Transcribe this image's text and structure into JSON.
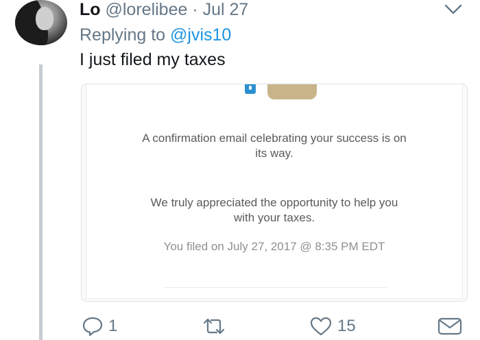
{
  "tweet": {
    "name": "Lo",
    "handle": "@lorelibee",
    "separator": "·",
    "date": "Jul 27",
    "replying_prefix": "Replying to",
    "replying_to": "@jvis10",
    "text": "I just filed my taxes"
  },
  "media": {
    "line1": "A confirmation email celebrating your success is on",
    "line2": "its way.",
    "line3": "We truly appreciated the opportunity to help you",
    "line4": "with your taxes.",
    "line5": "You filed on July 27, 2017 @ 8:35 PM EDT"
  },
  "actions": {
    "reply_count": "1",
    "like_count": "15"
  },
  "colors": {
    "name": "#14171a",
    "secondary": "#657786",
    "link": "#1b95e0",
    "thread_line": "#c5ccd3"
  },
  "icons": [
    "chevron-down-icon",
    "reply-icon",
    "retweet-icon",
    "heart-icon",
    "envelope-icon"
  ]
}
